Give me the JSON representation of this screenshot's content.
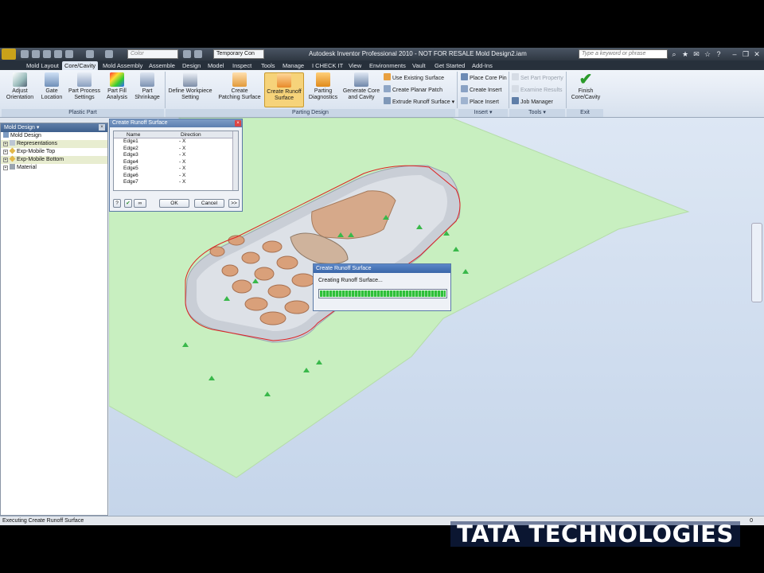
{
  "window_title": "Autodesk Inventor Professional 2010 - NOT FOR RESALE   Mold Design2.iam",
  "quick_access": {
    "color_combo": "Color",
    "view_rep_combo": "Temporary Con"
  },
  "search_placeholder": "Type a keyword or phrase",
  "tabs": [
    "Mold Layout",
    "Core/Cavity",
    "Mold Assembly",
    "Assemble",
    "Design",
    "Model",
    "Inspect",
    "Tools",
    "Manage",
    "I CHECK IT",
    "View",
    "Environments",
    "Vault",
    "Get Started",
    "Add-Ins"
  ],
  "active_tab": "Core/Cavity",
  "ribbon": {
    "plastic_part": {
      "label": "Plastic Part",
      "buttons": [
        {
          "l1": "Adjust",
          "l2": "Orientation"
        },
        {
          "l1": "Gate",
          "l2": "Location"
        },
        {
          "l1": "Part Process",
          "l2": "Settings"
        },
        {
          "l1": "Part Fill",
          "l2": "Analysis"
        },
        {
          "l1": "Part",
          "l2": "Shrinkage"
        }
      ]
    },
    "parting_design": {
      "label": "Parting Design",
      "buttons": [
        {
          "l1": "Define Workpiece",
          "l2": "Setting"
        },
        {
          "l1": "Create",
          "l2": "Patching Surface"
        },
        {
          "l1": "Create Runoff",
          "l2": "Surface"
        },
        {
          "l1": "Parting",
          "l2": "Diagnostics"
        },
        {
          "l1": "Generate Core",
          "l2": "and Cavity"
        }
      ],
      "small": [
        "Use Existing Surface",
        "Create Planar Patch",
        "Extrude Runoff Surface"
      ]
    },
    "insert": {
      "label": "Insert",
      "small": [
        "Place Core Pin",
        "Create Insert",
        "Place Insert"
      ]
    },
    "tools": {
      "label": "Tools",
      "small": [
        "Set Part Property",
        "Examine Results",
        "Job Manager"
      ]
    },
    "exit": {
      "label": "Exit",
      "button": {
        "l1": "Finish",
        "l2": "Core/Cavity"
      }
    }
  },
  "browser": {
    "header": "Mold Design",
    "items": [
      "Mold Design",
      "Representations",
      "Exp-Mobile Top",
      "Exp-Mobile Bottom",
      "Material"
    ]
  },
  "runoff_dialog": {
    "title": "Create Runoff Surface",
    "col_name": "Name",
    "col_direction": "Direction",
    "rows": [
      {
        "name": "Edge1",
        "dir": "- X"
      },
      {
        "name": "Edge2",
        "dir": "- X"
      },
      {
        "name": "Edge3",
        "dir": "- X"
      },
      {
        "name": "Edge4",
        "dir": "- X"
      },
      {
        "name": "Edge5",
        "dir": "- X"
      },
      {
        "name": "Edge6",
        "dir": "- X"
      },
      {
        "name": "Edge7",
        "dir": "- X"
      }
    ],
    "ok": "OK",
    "cancel": "Cancel",
    "more": ">>"
  },
  "progress_dialog": {
    "title": "Create Runoff Surface",
    "message": "Creating Runoff Surface...",
    "progress": 1.0
  },
  "status": {
    "text": "Executing Create Runoff Surface",
    "right": "0"
  },
  "logo": "TATA TECHNOLOGIES",
  "colors": {
    "runoff_surface": "#c8f0c0",
    "part_body": "#c9ced6",
    "part_keys": "#d39a6a",
    "viewport_bg": "#cfdcec",
    "progress": "#2fbf3a"
  }
}
